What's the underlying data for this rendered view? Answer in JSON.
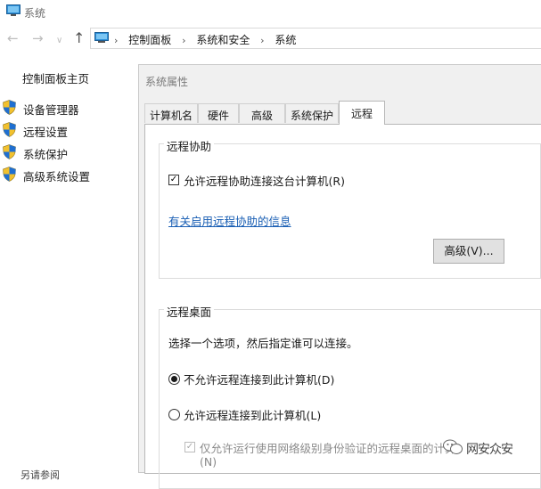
{
  "window": {
    "title": "系统"
  },
  "address": {
    "crumbs": [
      "控制面板",
      "系统和安全",
      "系统"
    ],
    "sep": "›"
  },
  "nav": {
    "back": "←",
    "forward": "→",
    "recent": "∨",
    "up": "↑"
  },
  "sidebar": {
    "home": "控制面板主页",
    "items": [
      {
        "label": "设备管理器",
        "icon": "shield-icon"
      },
      {
        "label": "远程设置",
        "icon": "shield-icon"
      },
      {
        "label": "系统保护",
        "icon": "shield-icon"
      },
      {
        "label": "高级系统设置",
        "icon": "shield-icon"
      }
    ],
    "cut_text": "另请参阅"
  },
  "dialog": {
    "title": "系统属性",
    "tabs": [
      "计算机名",
      "硬件",
      "高级",
      "系统保护",
      "远程"
    ],
    "active_tab": "远程",
    "assist": {
      "group_title": "远程协助",
      "allow_label": "允许远程协助连接这台计算机(R)",
      "allow_checked": true,
      "info_link": "有关启用远程协助的信息",
      "advanced_button": "高级(V)..."
    },
    "desktop": {
      "group_title": "远程桌面",
      "instruction": "选择一个选项，然后指定谁可以连接。",
      "options": [
        {
          "label": "不允许远程连接到此计算机(D)",
          "selected": true
        },
        {
          "label": "允许远程连接到此计算机(L)",
          "selected": false
        }
      ],
      "nla_label": "仅允许运行使用网络级别身份验证的远程桌面的计算",
      "nla_label_line2": "(N)",
      "nla_checked": true,
      "nla_enabled": false
    }
  },
  "watermark": {
    "text": "网安众安"
  },
  "colors": {
    "link": "#1a5fb4",
    "shield_blue": "#1f6fd1",
    "shield_yellow": "#f2c12e"
  }
}
